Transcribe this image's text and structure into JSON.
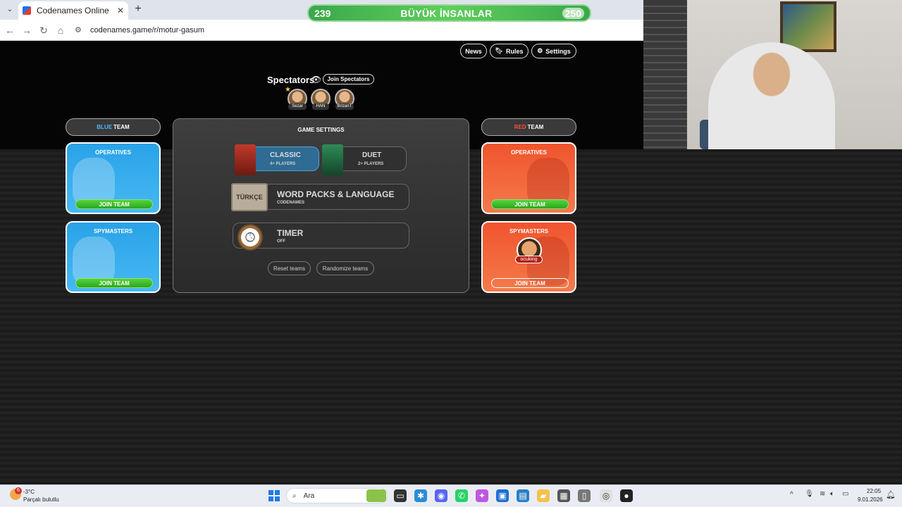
{
  "browser": {
    "tab_title": "Codenames Online",
    "tab_close": "✕",
    "tab_list": "⌄",
    "new_tab": "+",
    "url": "codenames.game/r/motur-gasum",
    "back": "←",
    "forward": "→",
    "reload": "↻",
    "home": "⌂"
  },
  "banner": {
    "left_value": "239",
    "title": "BÜYÜK İNSANLAR",
    "right_value": "250"
  },
  "header": {
    "news_label": "News",
    "rules_label": "Rules",
    "settings_label": "Settings"
  },
  "spectators": {
    "label": "Spectators",
    "join_label": "Join Spectators",
    "members": [
      "Sezar",
      "HAN",
      "BrizanT"
    ]
  },
  "blue_team": {
    "header_color_word": "BLUE",
    "header_rest": "TEAM",
    "operatives_title": "OPERATIVES",
    "operatives_join": "JOIN TEAM",
    "spymasters_title": "SPYMASTERS",
    "spymasters_join": "JOIN TEAM"
  },
  "red_team": {
    "header_color_word": "RED",
    "header_rest": "TEAM",
    "operatives_title": "OPERATIVES",
    "operatives_join": "JOIN TEAM",
    "spymasters_title": "SPYMASTERS",
    "spymaster_name": "ocuking",
    "spymasters_join": "JOIN TEAM"
  },
  "game_settings": {
    "title": "GAME SETTINGS",
    "classic_label": "CLASSIC",
    "classic_sub": "4+ PLAYERS",
    "duet_label": "DUET",
    "duet_sub": "2+ PLAYERS",
    "word_packs_label": "WORD PACKS & LANGUAGE",
    "word_packs_sub": "CODENAMES",
    "language_badge": "TÜRKÇE",
    "timer_label": "TIMER",
    "timer_sub": "OFF",
    "reset_teams_label": "Reset teams",
    "randomize_teams_label": "Randomize teams"
  },
  "taskbar": {
    "weather_temp": "-3°C",
    "weather_desc": "Parçalı bulutlu",
    "weather_badge": "6",
    "search_placeholder": "Ara",
    "time": "22:05",
    "date": "9.01.2026"
  },
  "colors": {
    "blue_accent": "#2aa2e8",
    "red_accent": "#f0542d",
    "join_green": "#3fbf2a",
    "banner_green": "#4cbd52"
  }
}
